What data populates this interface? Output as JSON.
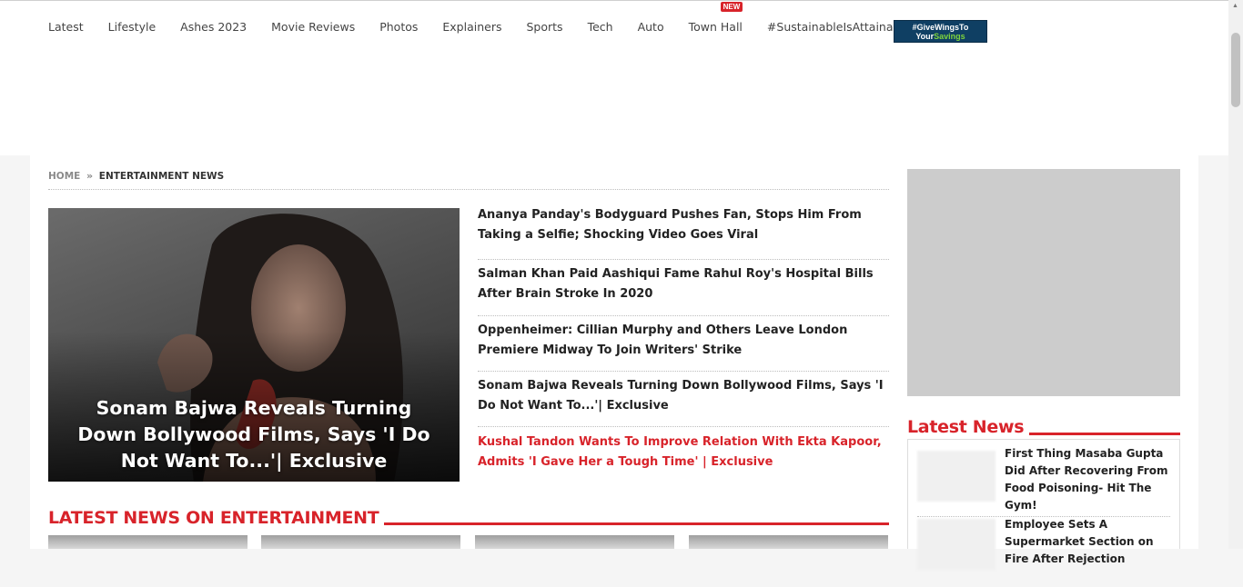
{
  "nav": {
    "items": [
      "Latest",
      "Lifestyle",
      "Ashes 2023",
      "Movie Reviews",
      "Photos",
      "Explainers",
      "Sports",
      "Tech",
      "Auto",
      "Town Hall",
      "#SustainableIsAttainable"
    ],
    "new_badge": "NEW",
    "promo_line1": "#GiveWingsTo",
    "promo_line2a": "Your",
    "promo_line2b": "Savings"
  },
  "breadcrumb": {
    "home": "HOME",
    "separator": "»",
    "current": "ENTERTAINMENT NEWS"
  },
  "hero": {
    "title": "Sonam Bajwa Reveals Turning Down Bollywood Films, Says 'I Do Not Want To...'| Exclusive"
  },
  "stories": [
    "Ananya Panday's Bodyguard Pushes Fan, Stops Him From Taking a Selfie; Shocking Video Goes Viral",
    "Salman Khan Paid Aashiqui Fame Rahul Roy's Hospital Bills After Brain Stroke In 2020",
    "Oppenheimer: Cillian Murphy and Others Leave London Premiere Midway To Join Writers' Strike",
    "Sonam Bajwa Reveals Turning Down Bollywood Films, Says 'I Do Not Want To...'| Exclusive",
    "Kushal Tandon Wants To Improve Relation With Ekta Kapoor, Admits 'I Gave Her a Tough Time' | Exclusive"
  ],
  "section": {
    "title": "LATEST NEWS ON ENTERTAINMENT"
  },
  "latest": {
    "title": "Latest News",
    "items": [
      "First Thing Masaba Gupta Did After Recovering From Food Poisoning- Hit The Gym!",
      "Employee Sets A Supermarket Section on Fire After Rejection"
    ]
  },
  "colors": {
    "accent": "#d8232a",
    "promo_bg": "#0f3f63",
    "promo_accent": "#7fd43d"
  }
}
